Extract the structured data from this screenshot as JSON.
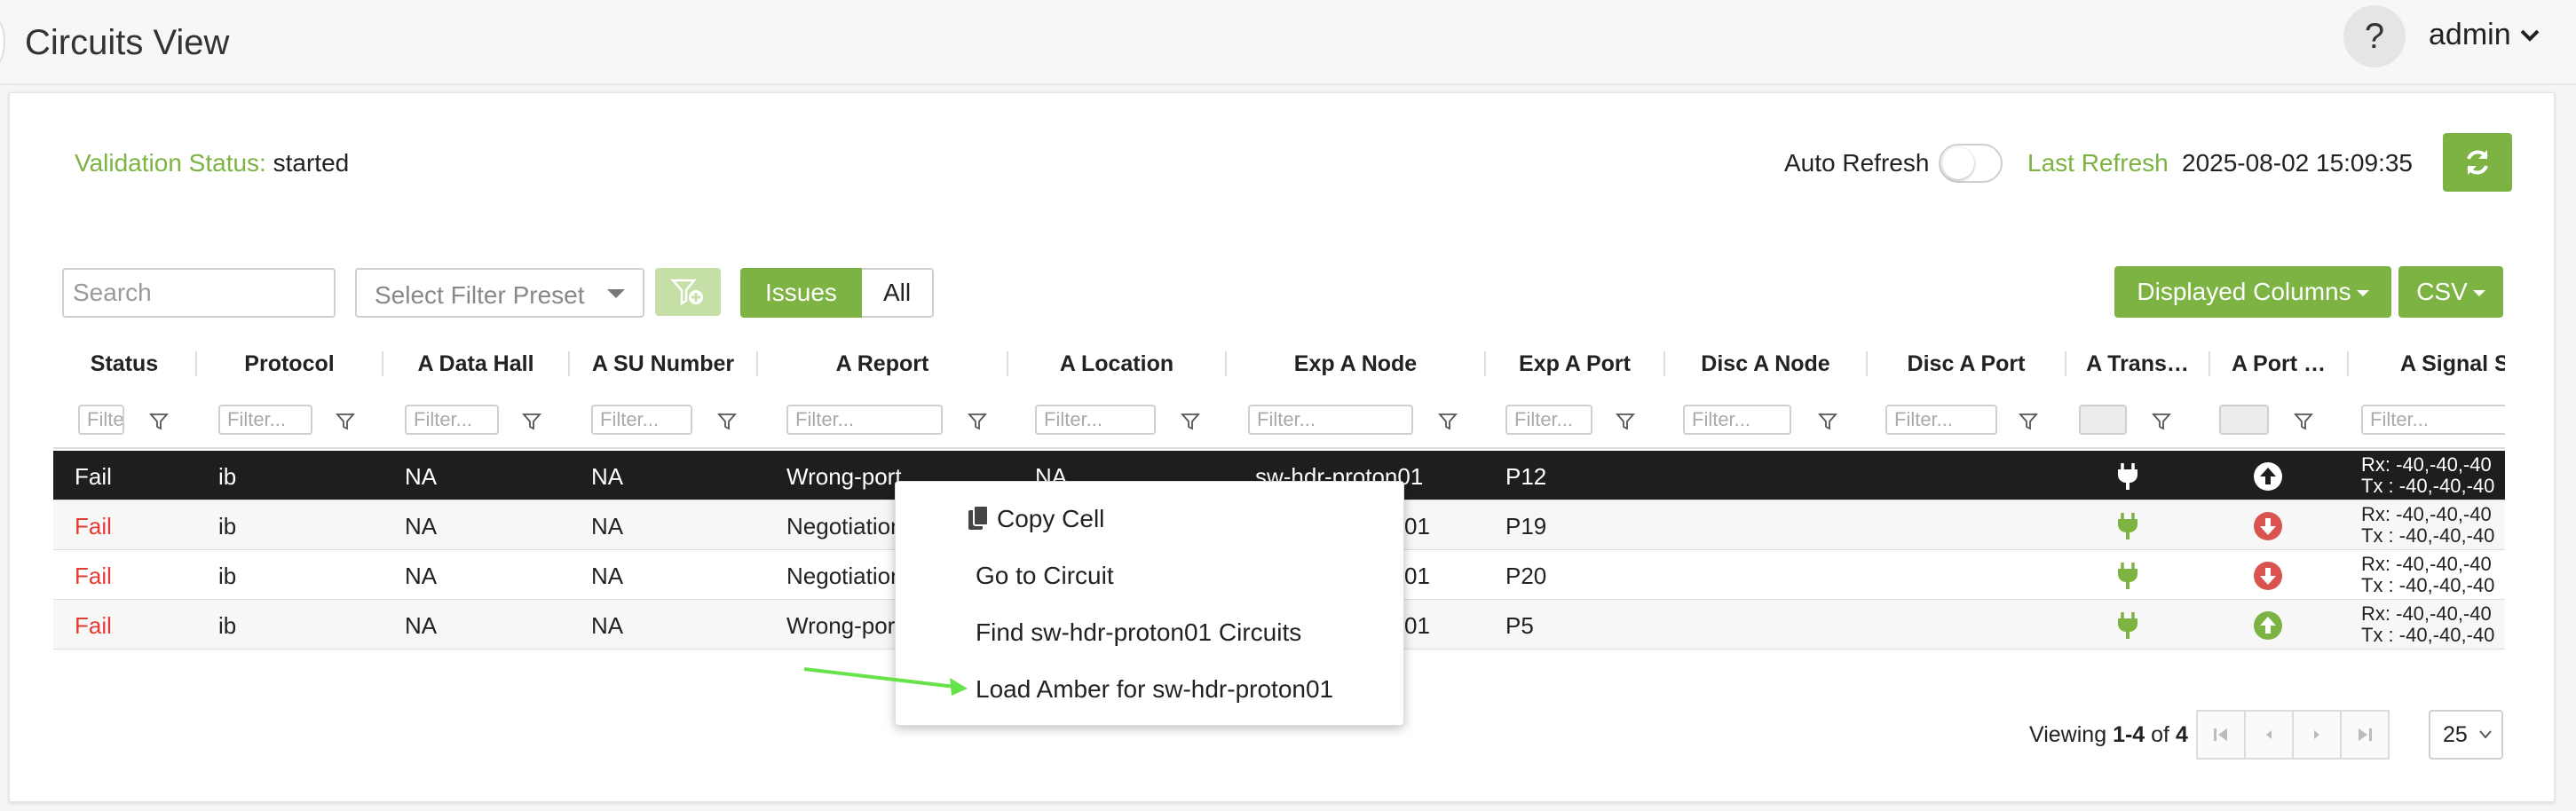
{
  "header": {
    "page_title": "Circuits View",
    "help_label": "?",
    "user_label": "admin"
  },
  "status_bar": {
    "validation_label": "Validation Status:",
    "validation_value": "started",
    "auto_refresh_label": "Auto Refresh",
    "auto_refresh_on": false,
    "last_refresh_label": "Last Refresh",
    "last_refresh_value": "2025-08-02 15:09:35"
  },
  "toolbar": {
    "search_placeholder": "Search",
    "preset_placeholder": "Select Filter Preset",
    "issues_label": "Issues",
    "all_label": "All",
    "displayed_columns_label": "Displayed Columns",
    "csv_label": "CSV"
  },
  "columns": [
    "Status",
    "Protocol",
    "A Data Hall",
    "A SU Number",
    "A Report",
    "A Location",
    "Exp A Node",
    "Exp A Port",
    "Disc A Node",
    "Disc A Port",
    "A Trans…",
    "A Port …",
    "A Signal S"
  ],
  "filter_placeholder": "Filter...",
  "filter_placeholder_short": "Filte",
  "rows": [
    {
      "status": "Fail",
      "protocol": "ib",
      "data_hall": "NA",
      "su_number": "NA",
      "report": "Wrong-port",
      "location": "NA",
      "exp_node": "sw-hdr-proton01",
      "exp_port": "P12",
      "port_state": "up-white",
      "rx": "Rx: -40,-40,-40",
      "tx": "Tx : -40,-40,-40"
    },
    {
      "status": "Fail",
      "protocol": "ib",
      "data_hall": "NA",
      "su_number": "NA",
      "report": "Negotiation",
      "location": "",
      "exp_node": "01",
      "exp_port": "P19",
      "port_state": "down-red",
      "rx": "Rx: -40,-40,-40",
      "tx": "Tx : -40,-40,-40"
    },
    {
      "status": "Fail",
      "protocol": "ib",
      "data_hall": "NA",
      "su_number": "NA",
      "report": "Negotiation",
      "location": "",
      "exp_node": "01",
      "exp_port": "P20",
      "port_state": "down-red",
      "rx": "Rx: -40,-40,-40",
      "tx": "Tx : -40,-40,-40"
    },
    {
      "status": "Fail",
      "protocol": "ib",
      "data_hall": "NA",
      "su_number": "NA",
      "report": "Wrong-port",
      "location": "",
      "exp_node": "01",
      "exp_port": "P5",
      "port_state": "up-green",
      "rx": "Rx: -40,-40,-40",
      "tx": "Tx : -40,-40,-40"
    }
  ],
  "context_menu": {
    "copy_cell": "Copy Cell",
    "go_to_circuit": "Go to Circuit",
    "find_circuits": "Find sw-hdr-proton01 Circuits",
    "load_amber": "Load Amber for sw-hdr-proton01"
  },
  "pagination": {
    "viewing_prefix": "Viewing",
    "range": "1-4",
    "of_label": "of",
    "total": "4",
    "page_size": "25"
  },
  "colors": {
    "accent_green": "#7cb342",
    "fail_red": "#e53935",
    "selected_row": "#1e1e1e",
    "arrow_green": "#66e34a"
  }
}
